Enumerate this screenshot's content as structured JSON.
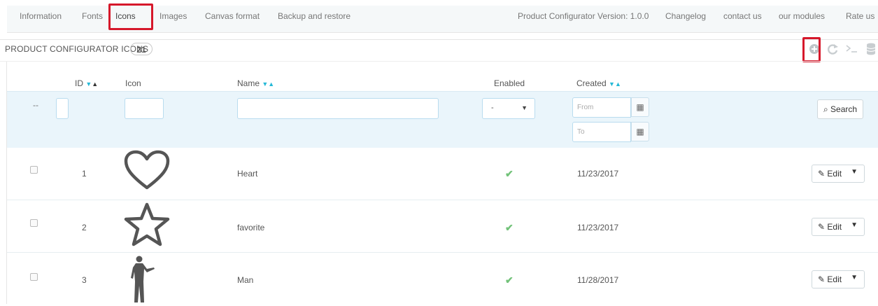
{
  "nav": {
    "left": [
      "Information",
      "Fonts",
      "Icons",
      "Images",
      "Canvas format",
      "Backup and restore"
    ],
    "version": "Product Configurator Version: 1.0.0",
    "right": [
      "Changelog",
      "contact us",
      "our modules",
      "Rate us"
    ]
  },
  "panel": {
    "title": "PRODUCT CONFIGURATOR ICONS",
    "count": "21",
    "toolbar_icons": [
      "add-icon",
      "refresh-icon",
      "sql-query-icon",
      "database-icon"
    ]
  },
  "table": {
    "headers": {
      "id": "ID",
      "icon": "Icon",
      "name": "Name",
      "enabled": "Enabled",
      "created": "Created"
    },
    "filter": {
      "dash": "--",
      "enabled_value": "-",
      "from_placeholder": "From",
      "to_placeholder": "To",
      "search_label": "Search"
    },
    "rows": [
      {
        "id": "1",
        "icon": "heart-icon",
        "name": "Heart",
        "enabled": true,
        "created": "11/23/2017",
        "action": "Edit"
      },
      {
        "id": "2",
        "icon": "star-icon",
        "name": "favorite",
        "enabled": true,
        "created": "11/23/2017",
        "action": "Edit"
      },
      {
        "id": "3",
        "icon": "man-icon",
        "name": "Man",
        "enabled": true,
        "created": "11/28/2017",
        "action": "Edit"
      }
    ]
  },
  "colors": {
    "highlight": "#d6182b",
    "accent": "#25b9d7",
    "enabled": "#72c279",
    "filter_bg": "#eaf5fb"
  }
}
